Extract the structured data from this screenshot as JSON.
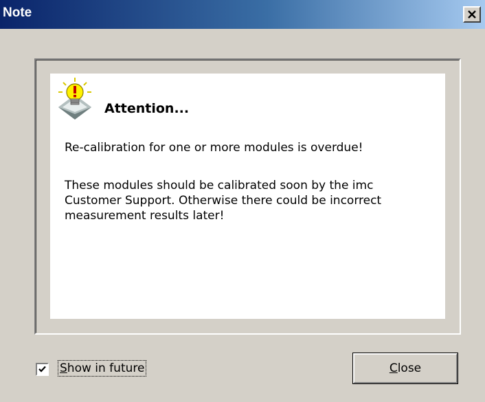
{
  "window": {
    "title": "Note",
    "close_glyph": "✕"
  },
  "message": {
    "icon": "lightbulb-warning-icon",
    "heading": "Attention...",
    "line1": "Re-calibration for one or more modules is overdue!",
    "line2": "These modules should be calibrated soon by the imc Customer Support. Otherwise there could be incorrect measurement results later!"
  },
  "footer": {
    "checkbox_checked": true,
    "checkbox_label_first": "S",
    "checkbox_label_rest": "how in future",
    "close_label_first": "C",
    "close_label_rest": "lose"
  },
  "colors": {
    "title_start": "#0a246a",
    "title_end": "#a6caf0",
    "face": "#d4d0c8"
  }
}
